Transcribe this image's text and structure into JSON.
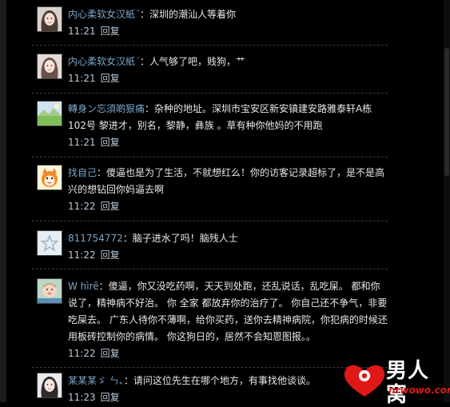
{
  "comments": [
    {
      "user": "内心柔软女汉紙ˊ",
      "text": "：深圳的潮汕人等着你",
      "time": "11:21",
      "reply": "回复",
      "avatar": "girl-portrait"
    },
    {
      "user": "内心柔软女汉紙ˊ",
      "text": "：人气够了吧，贱狗，艹",
      "time": "11:21",
      "reply": "回复",
      "avatar": "girl-portrait"
    },
    {
      "user": "轉身ン忘須啲狠痛",
      "text": "：杂种的地址。深圳市宝安区新安镇建安路雅泰轩A栋102号 黎进才，别名，黎静，彝族 。草有种你他妈的不用跑",
      "time": "11:21",
      "reply": "回复",
      "avatar": "landscape"
    },
    {
      "user": "找自己",
      "text": "：傻逼也是为了生活，不就想红么！你的访客记录超标了，是不是高兴的想钻回你妈逼去啊",
      "time": "11:22",
      "reply": "回复",
      "avatar": "cartoon"
    },
    {
      "user": "811754772",
      "text": "：脑子进水了吗！脑残人士",
      "time": "11:22",
      "reply": "回复",
      "avatar": "default-star"
    },
    {
      "user": "W hìrê",
      "text": "：傻逼，你又没吃药啊，天天到处跑，还乱说话，乱吃屎。 都和你说了，精神病不好治。 你 全家 都放弃你的治疗了。 你自己还不争气，非要吃屎去。 广东人待你不薄啊，给你买药，送你去精神病院，你犯病的时候还用板砖控制你的病情。 你这狗日的，居然不会知恩图报。。",
      "time": "11:22",
      "reply": "回复",
      "avatar": "baby"
    },
    {
      "user": "某某某ゞ ㄣ、",
      "text": "：请问这位先生在哪个地方，有事找他谈谈。",
      "time": "11:23",
      "reply": "回复",
      "avatar": "girl-portrait"
    }
  ],
  "watermark": {
    "brand": "男人窝",
    "url": "nrwowo.com"
  },
  "colors": {
    "background": "#000000",
    "username": "#7aa6c8",
    "text": "#e8e8e8",
    "meta": "#b8c9da",
    "divider": "#3a3a3a",
    "logo_red": "#e01818"
  }
}
